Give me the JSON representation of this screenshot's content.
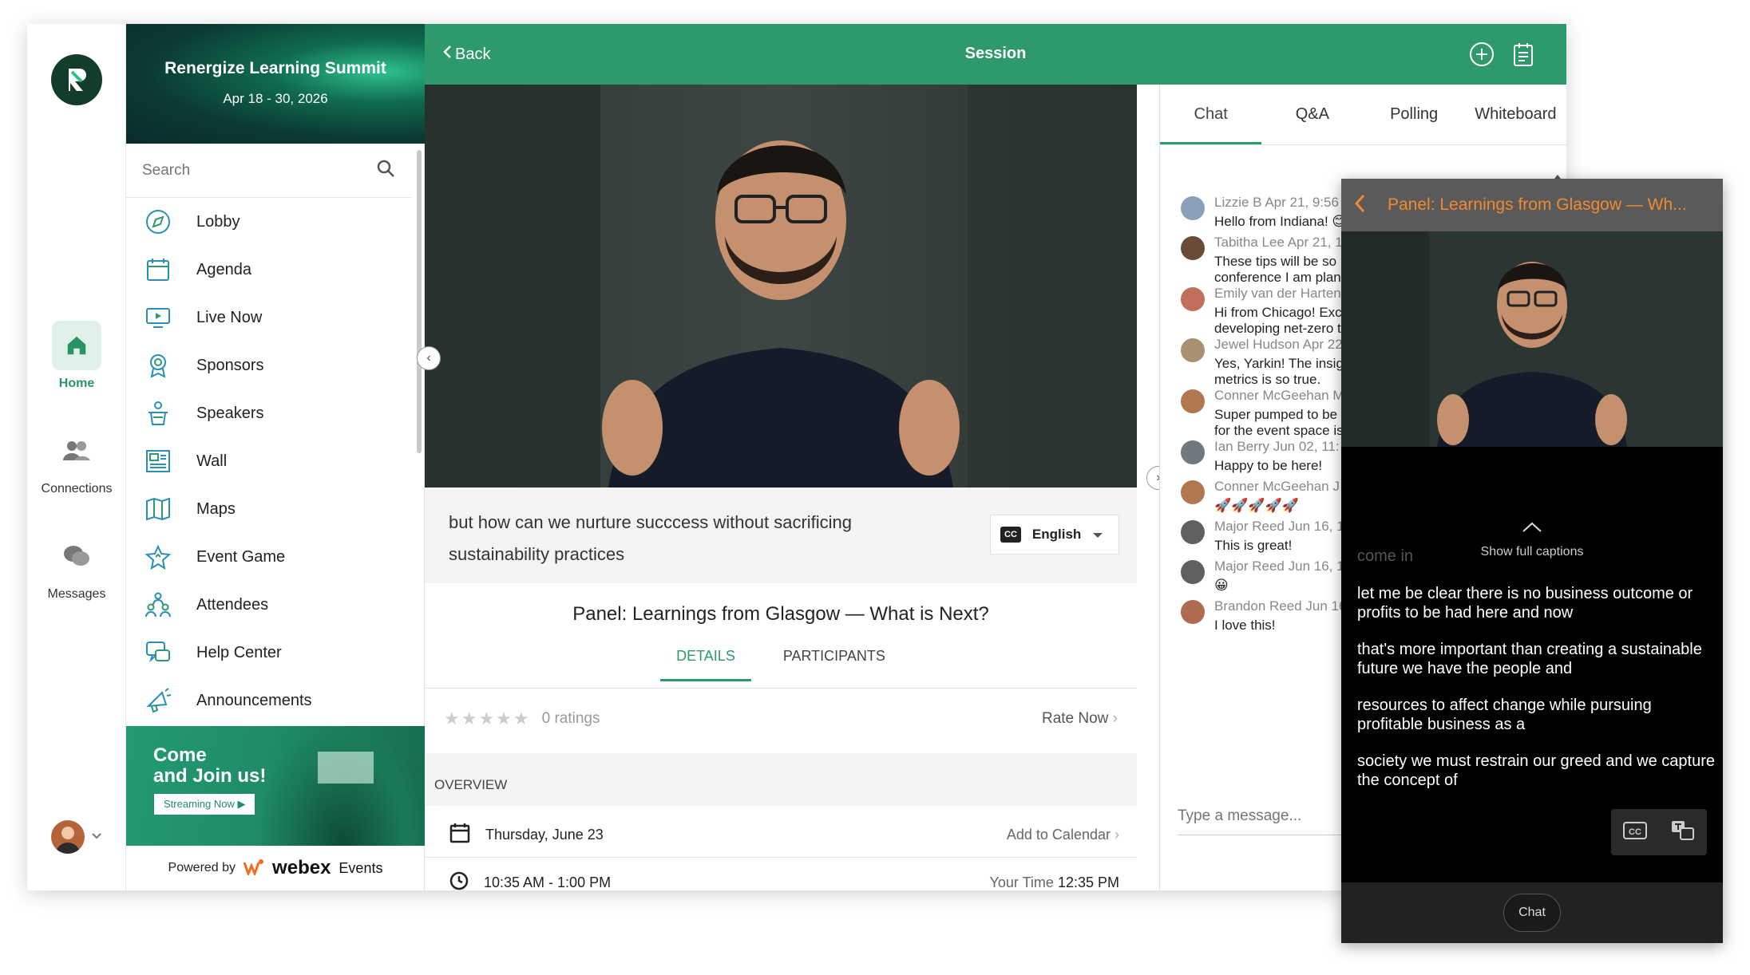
{
  "rail": {
    "items": [
      {
        "label": "Home",
        "icon": "home-icon",
        "active": true
      },
      {
        "label": "Connections",
        "icon": "connections-icon",
        "active": false
      },
      {
        "label": "Messages",
        "icon": "messages-icon",
        "active": false
      }
    ]
  },
  "event": {
    "title": "Renergize Learning Summit",
    "dates": "Apr 18 - 30, 2026"
  },
  "search": {
    "placeholder": "Search"
  },
  "nav": {
    "items": [
      {
        "label": "Lobby",
        "icon": "compass-icon"
      },
      {
        "label": "Agenda",
        "icon": "calendar-icon"
      },
      {
        "label": "Live Now",
        "icon": "live-screen-icon"
      },
      {
        "label": "Sponsors",
        "icon": "trophy-icon"
      },
      {
        "label": "Speakers",
        "icon": "podium-icon"
      },
      {
        "label": "Wall",
        "icon": "wall-icon"
      },
      {
        "label": "Maps",
        "icon": "map-icon"
      },
      {
        "label": "Event Game",
        "icon": "star-icon"
      },
      {
        "label": "Attendees",
        "icon": "attendees-icon"
      },
      {
        "label": "Help Center",
        "icon": "help-chat-icon"
      },
      {
        "label": "Announcements",
        "icon": "megaphone-icon"
      }
    ]
  },
  "promo": {
    "title_line1": "Come",
    "title_line2": "and Join us!",
    "button": "Streaming Now ▶"
  },
  "powered": {
    "prefix": "Powered by",
    "brand": "webex",
    "brand_sub": "Events"
  },
  "header": {
    "back": "Back",
    "title": "Session"
  },
  "caption": {
    "text": "but how can we nurture succcess without sacrificing sustainability practices",
    "cc": "CC",
    "language": "English"
  },
  "session": {
    "title": "Panel: Learnings from Glasgow — What is Next?",
    "tabs": [
      "DETAILS",
      "PARTICIPANTS"
    ],
    "ratings": "0 ratings",
    "rate_now": "Rate Now",
    "overview": "OVERVIEW",
    "date": "Thursday, June 23",
    "add_calendar": "Add to Calendar",
    "time": "10:35 AM - 1:00 PM",
    "your_time_label": "Your Time",
    "your_time": "12:35 PM"
  },
  "chat": {
    "tabs": [
      "Chat",
      "Q&A",
      "Polling",
      "Whiteboard"
    ],
    "placeholder": "Type a message...",
    "messages": [
      {
        "name": "Lizzie B",
        "time": "Apr 21, 9:56 AM",
        "body": "Hello from Indiana! 😊",
        "color": "#8aa0b8"
      },
      {
        "name": "Tabitha Lee",
        "time": "Apr 21, 1",
        "body": "These tips will be so\nconference I am plan",
        "color": "#6b4a3a"
      },
      {
        "name": "Emily van der Harten",
        "time": "",
        "body": "Hi from Chicago! Exc\ndeveloping net-zero t",
        "color": "#c0705a"
      },
      {
        "name": "Jewel Hudson",
        "time": "Apr 22",
        "body": "Yes, Yarkin! The insig\nmetrics is so true.",
        "color": "#a89070"
      },
      {
        "name": "Conner McGeehan",
        "time": "M",
        "body": "Super pumped to be\nfor the event space is",
        "color": "#b07850"
      },
      {
        "name": "Ian Berry",
        "time": "Jun 02, 11:",
        "body": "Happy to be here!",
        "color": "#707880"
      },
      {
        "name": "Conner McGeehan",
        "time": "J",
        "body": "🚀🚀🚀🚀🚀",
        "color": "#b07850"
      },
      {
        "name": "Major Reed",
        "time": "Jun 16, 1",
        "body": "This is great!",
        "color": "#606060"
      },
      {
        "name": "Major Reed",
        "time": "Jun 16, 1",
        "body": "😀",
        "color": "#606060"
      },
      {
        "name": "Brandon Reed",
        "time": "Jun 16",
        "body": "I love this!",
        "color": "#b06a50"
      }
    ]
  },
  "pip": {
    "title": "Panel: Learnings from Glasgow — Wh...",
    "faded": "come in",
    "show_full": "Show full captions",
    "captions": [
      "let me be clear there is no business outcome or profits to be had here and now",
      "that's more important than creating a sustainable future we have the people and",
      "resources to affect change while pursuing profitable business as a",
      "society we must restrain our greed and we capture the concept of"
    ],
    "chat_button": "Chat"
  },
  "colors": {
    "brand_green": "#2e9a6b",
    "pip_title": "#f08a2e"
  }
}
